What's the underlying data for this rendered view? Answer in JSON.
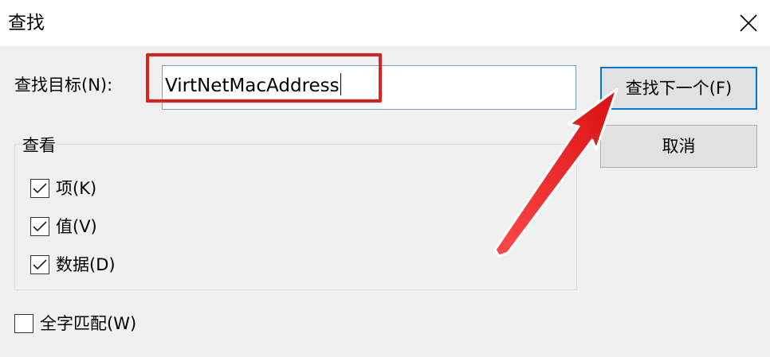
{
  "window": {
    "title": "查找"
  },
  "find": {
    "label": "查找目标(N):",
    "value": "VirtNetMacAddress"
  },
  "buttons": {
    "find_next": "查找下一个(F)",
    "cancel": "取消"
  },
  "look_at": {
    "legend": "查看",
    "options": [
      {
        "label": "项(K)",
        "checked": true
      },
      {
        "label": "值(V)",
        "checked": true
      },
      {
        "label": "数据(D)",
        "checked": true
      }
    ]
  },
  "match_whole": {
    "label": "全字匹配(W)",
    "checked": false
  },
  "annotation": {
    "highlight_color": "#e0201b",
    "arrow_color": "#e81e1e"
  },
  "icons": {
    "close": "close-icon",
    "checkmark": "checkmark-icon",
    "arrow": "red-arrow-icon"
  }
}
